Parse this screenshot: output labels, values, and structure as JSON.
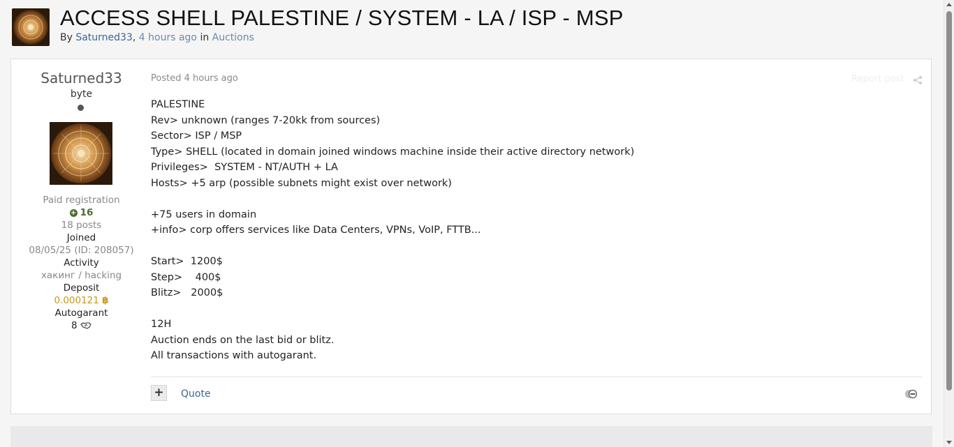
{
  "topic": {
    "title": "ACCESS SHELL PALESTINE / SYSTEM - LA / ISP - MSP",
    "by_label": "By",
    "author": "Saturned33",
    "comma": ",",
    "time": "4 hours ago",
    "in_label": "in",
    "forum": "Auctions"
  },
  "author_panel": {
    "name": "Saturned33",
    "rank": "byte",
    "group": "Paid registration",
    "reputation": "16",
    "posts": "18 posts",
    "joined_label": "Joined",
    "joined_value": "08/05/25 (ID: 208057)",
    "activity_label": "Activity",
    "activity_value": "хакинг / hacking",
    "deposit_label": "Deposit",
    "deposit_value": "0.000121",
    "deposit_icon": "bitcoin-icon",
    "autogarant_label": "Autogarant",
    "autogarant_value": "8",
    "autogarant_icon": "handshake-icon"
  },
  "post": {
    "posted_label": "Posted",
    "posted_time": "4 hours ago",
    "report_label": "Report post",
    "share_icon": "share-icon",
    "lines": [
      "PALESTINE",
      "Rev> unknown (ranges 7-20kk from sources)",
      "Sector> ISP / MSP",
      "Type> SHELL (located in domain joined windows machine inside their active directory network)",
      "Privileges>  SYSTEM - NT/AUTH + LA",
      "Hosts> +5 arp (possible subnets might exist over network)",
      "",
      "+75 users in domain",
      "+info> corp offers services like Data Centers, VPNs, VoIP, FTTB...",
      "",
      "Start>  1200$",
      "Step>    400$",
      "Blitz>   2000$",
      "",
      "12H",
      "Auction ends on the last bid or blitz.",
      "All transactions with autogarant."
    ],
    "multiquote_label": "+",
    "quote_label": "Quote",
    "react_icon": "reaction-icon"
  },
  "colors": {
    "link": "#3d6594",
    "reputation": "#4b6b2f",
    "deposit": "#c79a1a",
    "muted": "#888888"
  }
}
